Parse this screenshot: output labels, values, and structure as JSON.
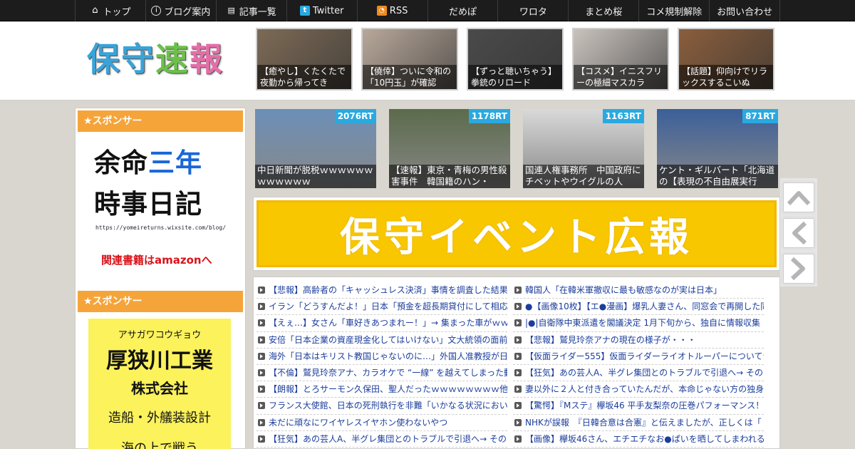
{
  "nav": [
    {
      "label": "トップ",
      "icon": "home-icon"
    },
    {
      "label": "ブログ案内",
      "icon": "info-icon"
    },
    {
      "label": "記事一覧",
      "icon": "list-icon"
    },
    {
      "label": "Twitter",
      "icon": "twitter-icon"
    },
    {
      "label": "RSS",
      "icon": "rss-icon"
    },
    {
      "label": "だめぽ"
    },
    {
      "label": "ワロタ"
    },
    {
      "label": "まとめ桜"
    },
    {
      "label": "コメ規制解除"
    },
    {
      "label": "お問い合わせ"
    }
  ],
  "logo": {
    "chars": [
      "保",
      "守",
      "速",
      "報"
    ],
    "colors": [
      "#3aa3d9",
      "#3aa3d9",
      "#6cc04a",
      "#e46ea8"
    ]
  },
  "header_thumbs": [
    {
      "caption": "【癒やし】くたくたで夜勤から帰ってき",
      "bg": "#7d6a55"
    },
    {
      "caption": "【僥倖】ついに令和の「10円玉」が確認",
      "bg": "#b8a89a"
    },
    {
      "caption": "【ずっと聴いちゃう】拳銃のリロード",
      "bg": "#4a4a4a"
    },
    {
      "caption": "【コスメ】イニスフリーの極細マスカラ",
      "bg": "#c9c3bd"
    },
    {
      "caption": "【話題】仰向けでリラックスするこいぬ",
      "bg": "#8a5e3c"
    }
  ],
  "sidebar": {
    "sponsor_label": "★スポンサー",
    "ad1": {
      "line1_a": "余命",
      "line1_b": "三年",
      "line2": "時事日記",
      "url": "https://yomeireturns.wixsite.com/blog/",
      "link": "関連書籍はamazonへ"
    },
    "ad2": {
      "kana": "アサガワコウギョウ",
      "name": "厚狭川工業",
      "company": "株式会社",
      "business": "造船・外艤装設計",
      "bottom": "海の上で戦う"
    }
  },
  "rt_items": [
    {
      "count": "2076RT",
      "caption": "中日新聞が脱税ｗｗｗｗｗｗｗｗｗｗｗｗ",
      "bg": "#6c8fb8"
    },
    {
      "count": "1178RT",
      "caption": "【速報】東京・青梅の男性殺害事件　韓国籍のハン・",
      "bg": "#5b6b4b"
    },
    {
      "count": "1163RT",
      "caption": "国連人権事務所　中国政府にチベットやウイグルの人",
      "bg": "#d9d9d9"
    },
    {
      "count": "871RT",
      "caption": "ケント・ギルバート「北海道の【表現の不自由展実行",
      "bg": "#3b5f9a"
    }
  ],
  "banner": {
    "text": "保守イベント広報"
  },
  "feeds_left": [
    "【悲報】高齢者の「キャッシュレス決済」事情を調査した結果",
    "イラン「どうすんだよ！」日本「預金を超長期貸付にして相応",
    "【えぇ…】女さん「車好きあつまれー！」→ 集まった車がｗｗ",
    "安倍「日本企業の資産現金化してはいけない」文大統領の面前",
    "海外「日本はキリスト教国じゃないのに…」外国人准教授が日",
    "【不倫】鷲見玲奈アナ、カラオケで “一線” を越えてしまった動",
    "【朗報】とろサーモン久保田、聖人だったｗｗｗｗｗｗｗｗ他",
    "フランス大使館、日本の死刑執行を非難「いかなる状況におい",
    "未だに頑なにワイヤレスイヤホン使わないやつ",
    "【狂気】あの芸人A、半グレ集団とのトラブルで引退へ→ その"
  ],
  "feeds_right": [
    "韓国人「在韓米軍撤収に最も敏感なのが実は日本」",
    "●【画像10枚】【エ●漫画】爆乳人妻さん、同窓会で再開した同",
    "|●|自衛隊中東派遣を閣議決定 1月下旬から、独自に情報収集 ホ",
    "【悲報】鷲見玲奈アナの現在の様子が・・・",
    "【仮面ライダー555】仮面ライダーライオトルーパーについてか",
    "【狂気】あの芸人A、半グレ集団とのトラブルで引退へ→ その",
    "妻以外に２人と付き合っていたんだが、本命じゃない方の独身",
    "【驚愕】『Mステ』欅坂46 平手友梨奈の圧巻パフォーマンス！",
    "NHKが誤報　『日韓合意は合憲』と伝えましたが、正しくは「",
    "【画像】欅坂46さん、エチエチなお●ぱいを晒してしまわれるｗ"
  ],
  "side_buttons": [
    {
      "name": "scroll-top-button",
      "icon": "chevron-up-icon"
    },
    {
      "name": "prev-page-button",
      "icon": "chevron-left-icon"
    },
    {
      "name": "next-page-button",
      "icon": "chevron-right-icon"
    }
  ]
}
